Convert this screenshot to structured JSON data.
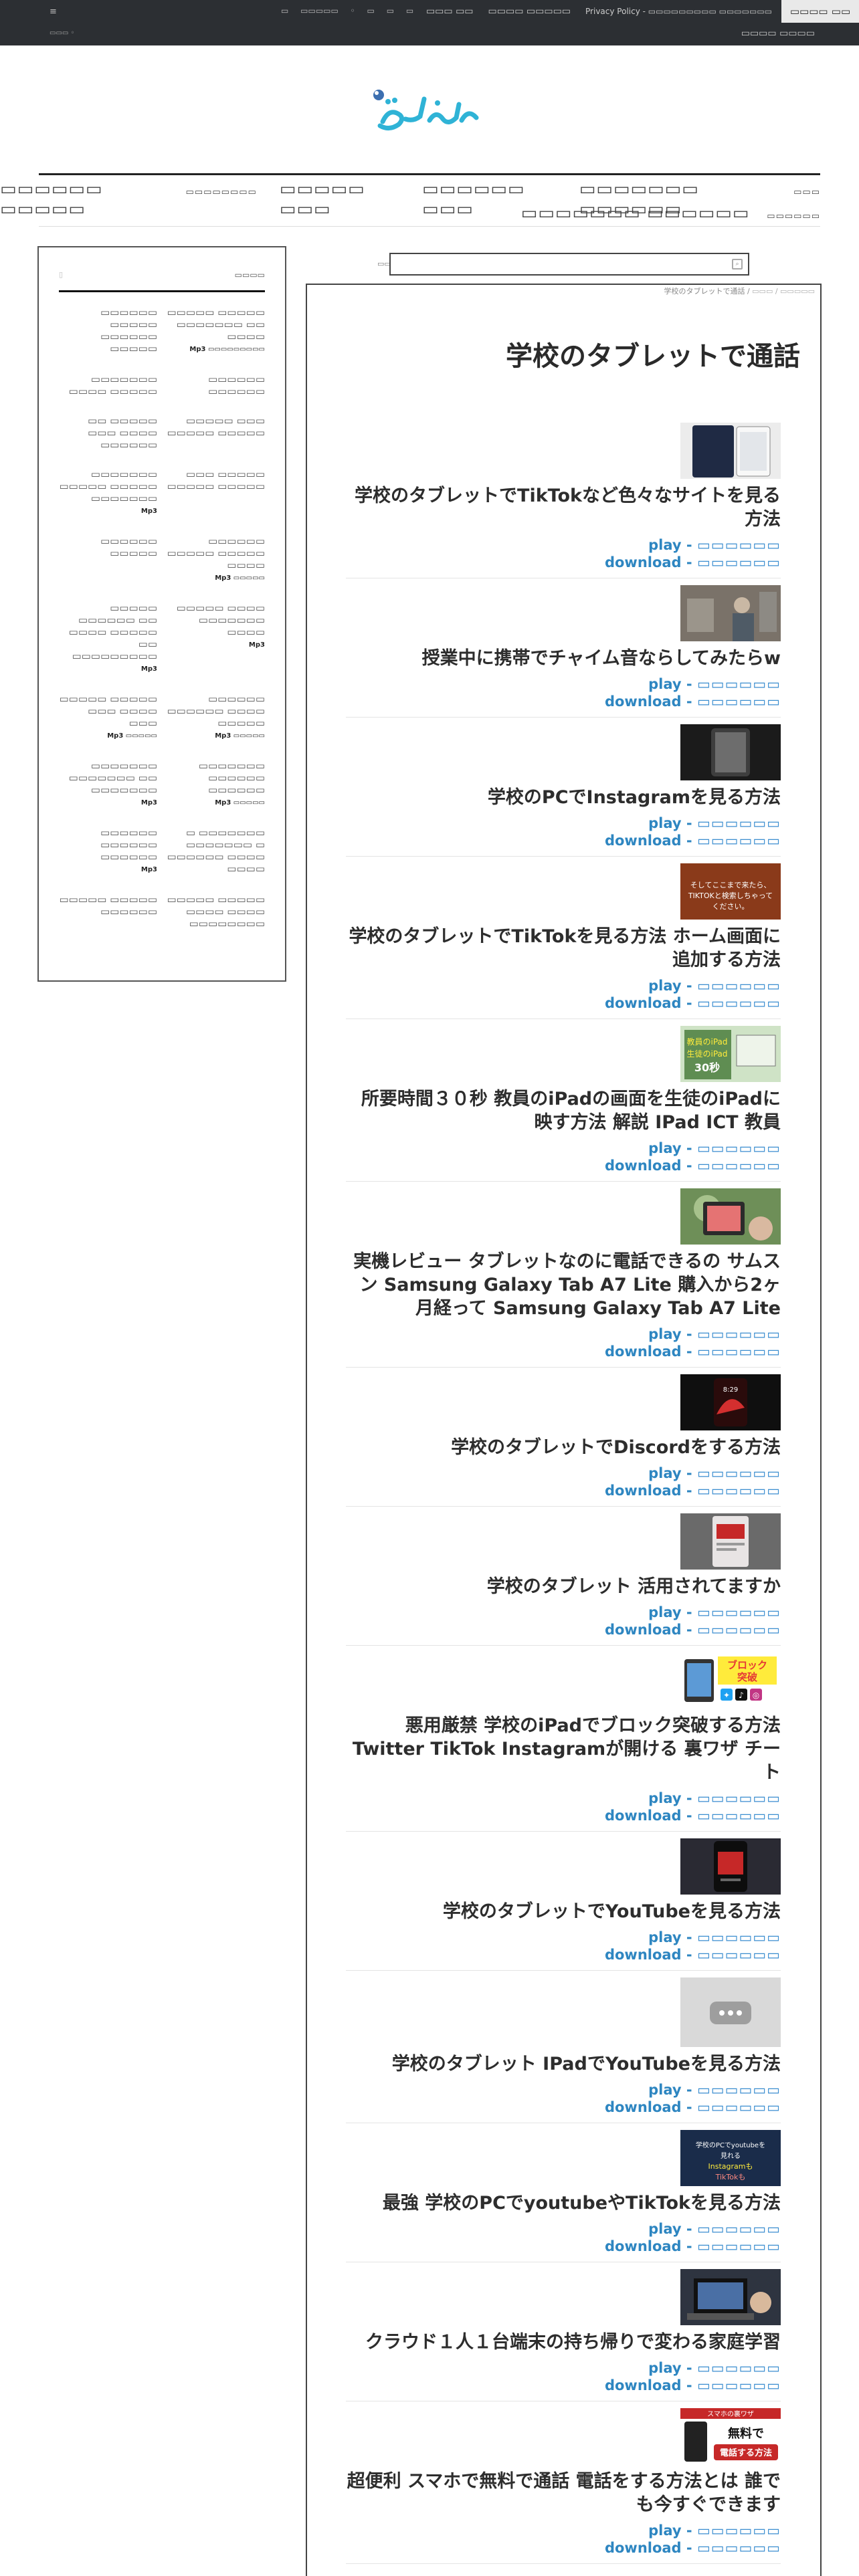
{
  "topbar": {
    "menu_icon": "menu-icon",
    "left_text": "≡",
    "left_sub": "▭▭▭ ◦",
    "social_icons": "▭ ▭▭▭▭▭ ◦ ▭ ▭ ▭",
    "links": [
      "▭▭▭ ▭▭",
      "▭▭▭▭ ▭▭▭▭▭",
      "Privacy Policy - ▭▭▭▭▭▭▭▭▭ ▭▭▭▭▭▭▭"
    ],
    "contact_label": "▭▭▭▭ ▭▭",
    "right_sub": "▭▭▭▭ ▭▭▭▭"
  },
  "brand": {
    "logo_alt": "site-logo",
    "colors": {
      "logo": "#2fb3d6",
      "accent": "#2e86c1"
    }
  },
  "nav": {
    "row1": [
      "▭▭▭▭▭▭ ▭▭▭▭▭",
      "▭▭▭▭▭▭▭▭",
      "▭▭▭▭▭ ▭▭▭",
      "▭▭▭▭▭▭ ▭▭▭",
      "▭▭▭▭▭▭▭ ▭▭▭▭▭▭",
      "▭▭▭"
    ],
    "row2": [
      "▭▭▭▭▭▭▭ ▭▭▭▭▭▭",
      "▭▭▭▭▭▭"
    ]
  },
  "sidebar": {
    "title": "▭▭▭▭",
    "query_marker": "▯",
    "items": [
      {
        "text": "▭▭▭▭▭▭ ▭▭▭▭▭ ▭▭▭▭▭▭ ▭▭▭▭▭",
        "mp3": ""
      },
      {
        "text": "▭▭▭▭▭ ▭▭▭▭▭ ▭▭▭▭▭▭▭ ▭▭ ▭▭▭▭",
        "mp3": "Mp3 ▭▭▭▭▭▭▭▭▭"
      },
      {
        "text": "▭▭▭▭▭▭▭ ▭▭▭▭ ▭▭▭▭▭",
        "mp3": ""
      },
      {
        "text": "▭▭▭▭▭▭ ▭▭▭▭▭▭",
        "mp3": ""
      },
      {
        "text": "▭▭ ▭▭▭▭▭ ▭▭▭ ▭▭▭▭ ▭▭▭▭▭▭",
        "mp3": ""
      },
      {
        "text": "▭▭▭▭▭ ▭▭▭ ▭▭▭▭▭ ▭▭▭▭▭",
        "mp3": ""
      },
      {
        "text": "▭▭▭▭▭▭▭ ▭▭▭▭▭ ▭▭▭▭▭ ▭▭▭▭▭▭▭",
        "mp3": "Mp3"
      },
      {
        "text": "▭▭▭ ▭▭▭▭▭ ▭▭▭▭▭ ▭▭▭▭▭",
        "mp3": ""
      },
      {
        "text": "▭▭▭▭▭▭ ▭▭▭▭▭",
        "mp3": ""
      },
      {
        "text": "▭▭▭▭▭▭ ▭▭▭▭▭ ▭▭▭▭▭ ▭▭▭▭",
        "mp3": "Mp3 ▭▭▭▭▭"
      },
      {
        "text": "▭▭▭▭▭ ▭▭▭▭▭▭ ▭▭ ▭▭▭▭ ▭▭▭▭▭ ▭▭ ▭▭▭▭▭▭▭▭▭",
        "mp3": "Mp3"
      },
      {
        "text": "▭▭▭▭▭ ▭▭▭▭ ▭▭▭▭▭▭▭ ▭▭▭▭",
        "mp3": "Mp3"
      },
      {
        "text": "▭▭▭▭▭ ▭▭▭▭▭ ▭▭▭ ▭▭▭▭ ▭▭▭",
        "mp3": "Mp3 ▭▭▭▭▭"
      },
      {
        "text": "▭▭▭▭▭▭ ▭▭▭▭▭▭ ▭▭▭▭ ▭▭▭▭▭",
        "mp3": "Mp3 ▭▭▭▭▭"
      },
      {
        "text": "▭▭▭▭▭▭▭ ▭▭▭▭▭▭▭ ▭▭ ▭▭▭▭▭▭▭",
        "mp3": "Mp3"
      },
      {
        "text": "▭▭▭▭▭▭▭ ▭▭▭▭▭▭ ▭▭▭▭▭▭",
        "mp3": "Mp3 ▭▭▭▭▭"
      },
      {
        "text": "▭▭▭▭▭▭ ▭▭▭▭▭▭ ▭▭▭▭▭▭",
        "mp3": "Mp3"
      },
      {
        "text": "▭ ▭▭▭▭▭▭▭ ▭▭▭▭▭▭▭ ▭ ▭▭▭▭▭▭ ▭▭▭▭ ▭▭▭▭",
        "mp3": ""
      },
      {
        "text": "▭▭▭▭▭ ▭▭▭▭▭ ▭▭▭▭▭▭",
        "mp3": ""
      },
      {
        "text": "▭▭▭▭▭ ▭▭▭▭▭ ▭▭▭▭ ▭▭▭▭ ▭▭▭▭▭▭▭▭",
        "mp3": ""
      }
    ]
  },
  "search": {
    "label": "▭▭",
    "value": "",
    "placeholder": ""
  },
  "breadcrumb": {
    "current": "学校のタブレットで通話",
    "sep": " / ",
    "home": "▭▭▭ / ▭▭▭▭▭"
  },
  "page_title": "学校のタブレットで通話",
  "link_labels": {
    "play": "play",
    "download": "download",
    "dash": " - ",
    "box": "▭▭▭▭▭▭"
  },
  "videos": [
    {
      "title": "学校のタブレットでTikTokなど色々なサイトを見る方法",
      "thumb": "tablet-dark"
    },
    {
      "title": "授業中に携帯でチャイム音ならしてみたらw",
      "thumb": "classroom"
    },
    {
      "title": "学校のPCでInstagramを見る方法",
      "thumb": "dark-screen"
    },
    {
      "title": "学校のタブレットでTikTokを見る方法 ホーム画面に追加する方法",
      "thumb": "orange-text"
    },
    {
      "title": "所要時間３０秒 教員のiPadの画面を生徒のiPadに映す方法 解説 IPad ICT 教員",
      "thumb": "green-ipad"
    },
    {
      "title": "実機レビュー タブレットなのに電話できるの サムスン Samsung Galaxy Tab A7 Lite 購入から2ヶ月経って Samsung Galaxy Tab A7 Lite",
      "thumb": "hands-tablet"
    },
    {
      "title": "学校のタブレットでDiscordをする方法",
      "thumb": "red-phone"
    },
    {
      "title": "学校のタブレット 活用されてますか",
      "thumb": "grey-device"
    },
    {
      "title": "悪用厳禁 学校のiPadでブロック突破する方法 Twitter TikTok Instagramが開ける 裏ワザ チート",
      "thumb": "block-break"
    },
    {
      "title": "学校のタブレットでYouTubeを見る方法",
      "thumb": "phone-dark"
    },
    {
      "title": "学校のタブレット IPadでYouTubeを見る方法",
      "thumb": "placeholder"
    },
    {
      "title": "最強 学校のPCでyoutubeやTikTokを見る方法",
      "thumb": "blue-text"
    },
    {
      "title": "クラウド１人１台端末の持ち帰りで変わる家庭学習",
      "thumb": "laptop-hands"
    },
    {
      "title": "超便利 スマホで無料で通話 電話をする方法とは 誰でも今すぐできます",
      "thumb": "free-call"
    }
  ],
  "badges": {
    "block_break": "ブロック\n突破",
    "free_call_top": "スマホの裏ワザ",
    "free_call_mid": "無料で",
    "free_call_btn": "電話する方法",
    "orange_text": "そしてここまで来たら、TIKTOKと検索しちゃってください。",
    "green_text": "教員のiPadを生徒のiPadに30秒",
    "blue_text": "学校のPCでyoutubeを見れるInstagramもTikTokも"
  }
}
